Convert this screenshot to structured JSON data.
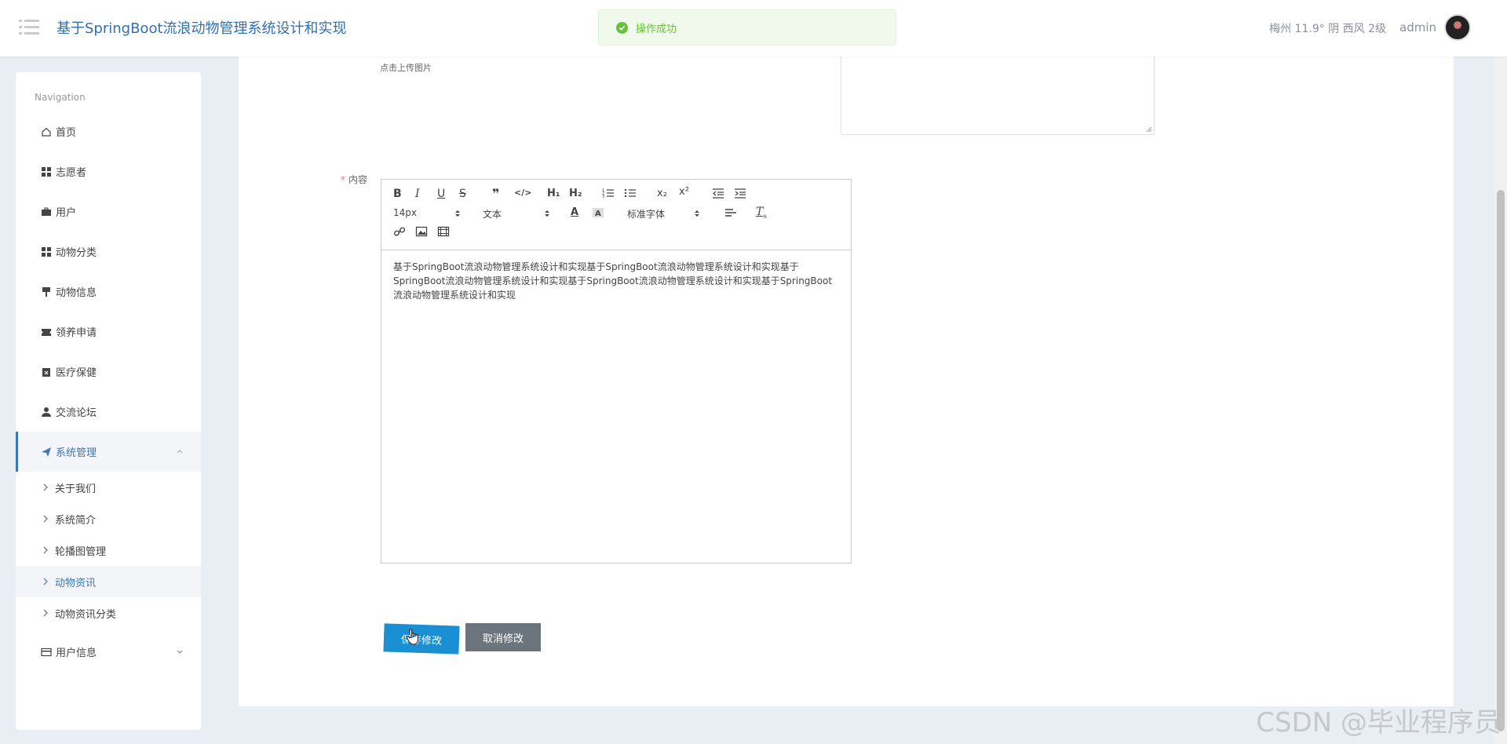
{
  "header": {
    "app_title": "基于SpringBoot流浪动物管理系统设计和实现",
    "toast_message": "操作成功",
    "weather": "梅州  11.9°  阴  西风  2级",
    "username": "admin"
  },
  "sidebar": {
    "nav_title": "Navigation",
    "items": [
      {
        "label": "首页",
        "icon": "home-icon"
      },
      {
        "label": "志愿者",
        "icon": "grid-icon"
      },
      {
        "label": "用户",
        "icon": "briefcase-icon"
      },
      {
        "label": "动物分类",
        "icon": "grid-icon"
      },
      {
        "label": "动物信息",
        "icon": "pin-icon"
      },
      {
        "label": "领养申请",
        "icon": "ticket-icon"
      },
      {
        "label": "医疗保健",
        "icon": "clipboard-icon"
      },
      {
        "label": "交流论坛",
        "icon": "user-icon"
      },
      {
        "label": "系统管理",
        "icon": "paper-plane-icon"
      }
    ],
    "sub_items": [
      "关于我们",
      "系统简介",
      "轮播图管理",
      "动物资讯",
      "动物资讯分类"
    ],
    "last_item": {
      "label": "用户信息",
      "icon": "card-icon"
    }
  },
  "main": {
    "upload_hint": "点击上传图片",
    "content_label": "内容",
    "required_mark": "*",
    "editor": {
      "font_size": "14px",
      "text_style": "文本",
      "font_family": "标准字体",
      "body_text": "基于SpringBoot流浪动物管理系统设计和实现基于SpringBoot流浪动物管理系统设计和实现基于SpringBoot流浪动物管理系统设计和实现基于SpringBoot流浪动物管理系统设计和实现基于SpringBoot流浪动物管理系统设计和实现"
    },
    "save_button": "保存修改",
    "cancel_button": "取消修改"
  },
  "watermark": "CSDN @毕业程序员",
  "colors": {
    "accent": "#3b77b8",
    "success": "#67c23a",
    "save": "#1a8fd4",
    "cancel": "#6c757d"
  }
}
